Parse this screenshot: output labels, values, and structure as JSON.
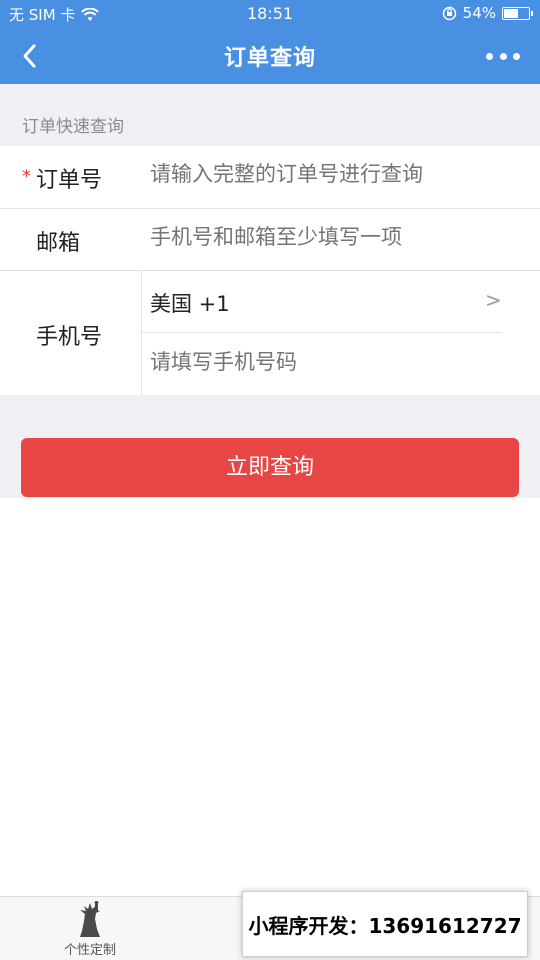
{
  "status": {
    "carrier": "无 SIM 卡",
    "time": "18:51",
    "battery": "54%",
    "battery_level": 0.54
  },
  "nav": {
    "title": "订单查询"
  },
  "section": {
    "title": "订单快速查询"
  },
  "form": {
    "order_label": "订单号",
    "required_mark": "*",
    "order_placeholder": "请输入完整的订单号进行查询",
    "email_label": "邮箱",
    "email_placeholder": "手机号和邮箱至少填写一项",
    "phone_label": "手机号",
    "country": "美国 +1",
    "chevron": ">",
    "phone_placeholder": "请填写手机号码"
  },
  "button": {
    "label": "立即查询"
  },
  "tabbar": {
    "items": [
      {
        "label": "个性定制",
        "icon": "statue-of-liberty-icon"
      }
    ]
  },
  "watermark": {
    "text": "小程序开发：13691612727"
  },
  "colors": {
    "primary": "#4a90e2",
    "button": "#e84545",
    "background": "#efeff4"
  }
}
